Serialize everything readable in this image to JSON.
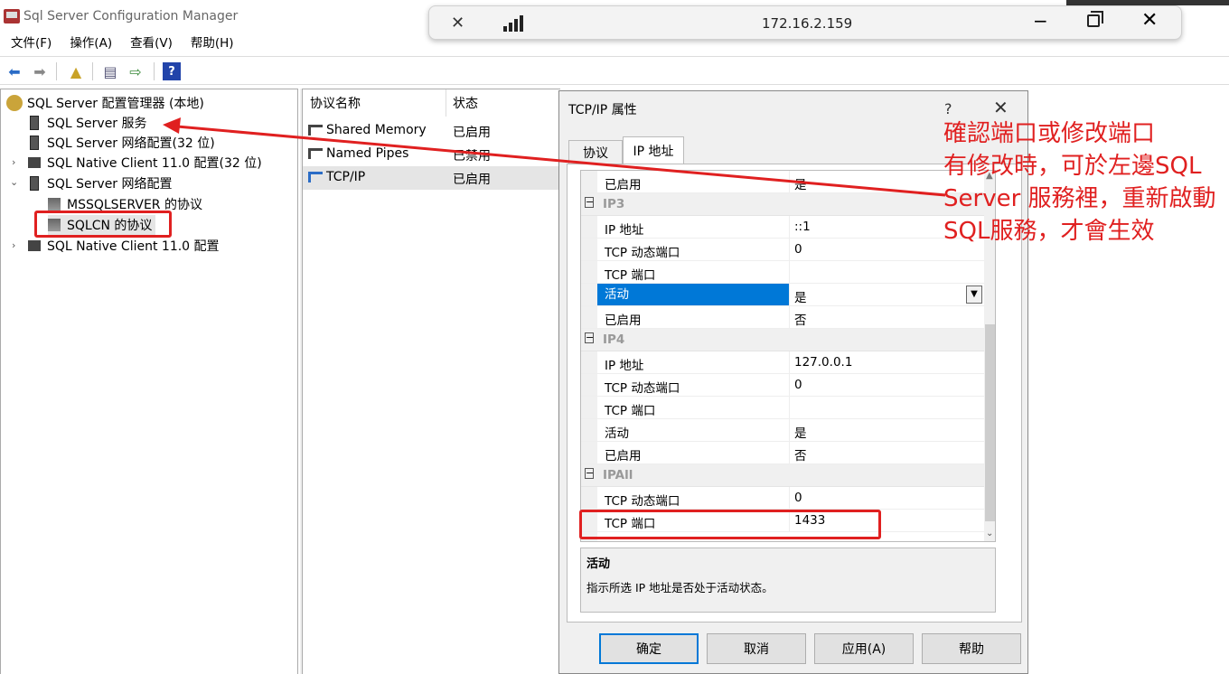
{
  "app": {
    "title": "Sql Server Configuration Manager"
  },
  "menu": [
    "文件(F)",
    "操作(A)",
    "查看(V)",
    "帮助(H)"
  ],
  "tree": {
    "root": "SQL Server 配置管理器 (本地)",
    "items": [
      "SQL Server 服务",
      "SQL Server 网络配置(32 位)",
      "SQL Native Client 11.0 配置(32 位)",
      "SQL Server 网络配置",
      "MSSQLSERVER 的协议",
      "SQLCN 的协议",
      "SQL Native Client 11.0 配置"
    ]
  },
  "list": {
    "headers": [
      "协议名称",
      "状态"
    ],
    "rows": [
      {
        "name": "Shared Memory",
        "status": "已启用"
      },
      {
        "name": "Named Pipes",
        "status": "已禁用"
      },
      {
        "name": "TCP/IP",
        "status": "已启用"
      }
    ]
  },
  "rdp": {
    "ip": "172.16.2.159",
    "minimize": "−",
    "close": "✕"
  },
  "dialog": {
    "title": "TCP/IP 属性",
    "help": "?",
    "close": "✕",
    "tabs": [
      "协议",
      "IP 地址"
    ],
    "grid": [
      {
        "k": "已启用",
        "v": "是"
      },
      {
        "cat": "IP3"
      },
      {
        "k": "IP 地址",
        "v": "::1"
      },
      {
        "k": "TCP 动态端口",
        "v": "0"
      },
      {
        "k": "TCP 端口",
        "v": ""
      },
      {
        "k": "活动",
        "v": "是",
        "selected": true
      },
      {
        "k": "已启用",
        "v": "否"
      },
      {
        "cat": "IP4"
      },
      {
        "k": "IP 地址",
        "v": "127.0.0.1"
      },
      {
        "k": "TCP 动态端口",
        "v": "0"
      },
      {
        "k": "TCP 端口",
        "v": ""
      },
      {
        "k": "活动",
        "v": "是"
      },
      {
        "k": "已启用",
        "v": "否"
      },
      {
        "cat": "IPAll"
      },
      {
        "k": "TCP 动态端口",
        "v": "0"
      },
      {
        "k": "TCP 端口",
        "v": "1433"
      }
    ],
    "desc_title": "活动",
    "desc_text": "指示所选 IP 地址是否处于活动状态。",
    "buttons": [
      "确定",
      "取消",
      "应用(A)",
      "帮助"
    ]
  },
  "annotation": {
    "lines": [
      "確認端口或修改端口",
      "有修改時，可於左邊SQL",
      "Server 服務裡，重新啟動",
      "SQL服務，才會生效"
    ],
    "color": "#e02020"
  },
  "icons": {
    "back": "arrow-left-icon",
    "forward": "arrow-right-icon",
    "up": "folder-up-icon",
    "properties": "properties-icon",
    "export": "export-icon",
    "help": "help-icon"
  }
}
